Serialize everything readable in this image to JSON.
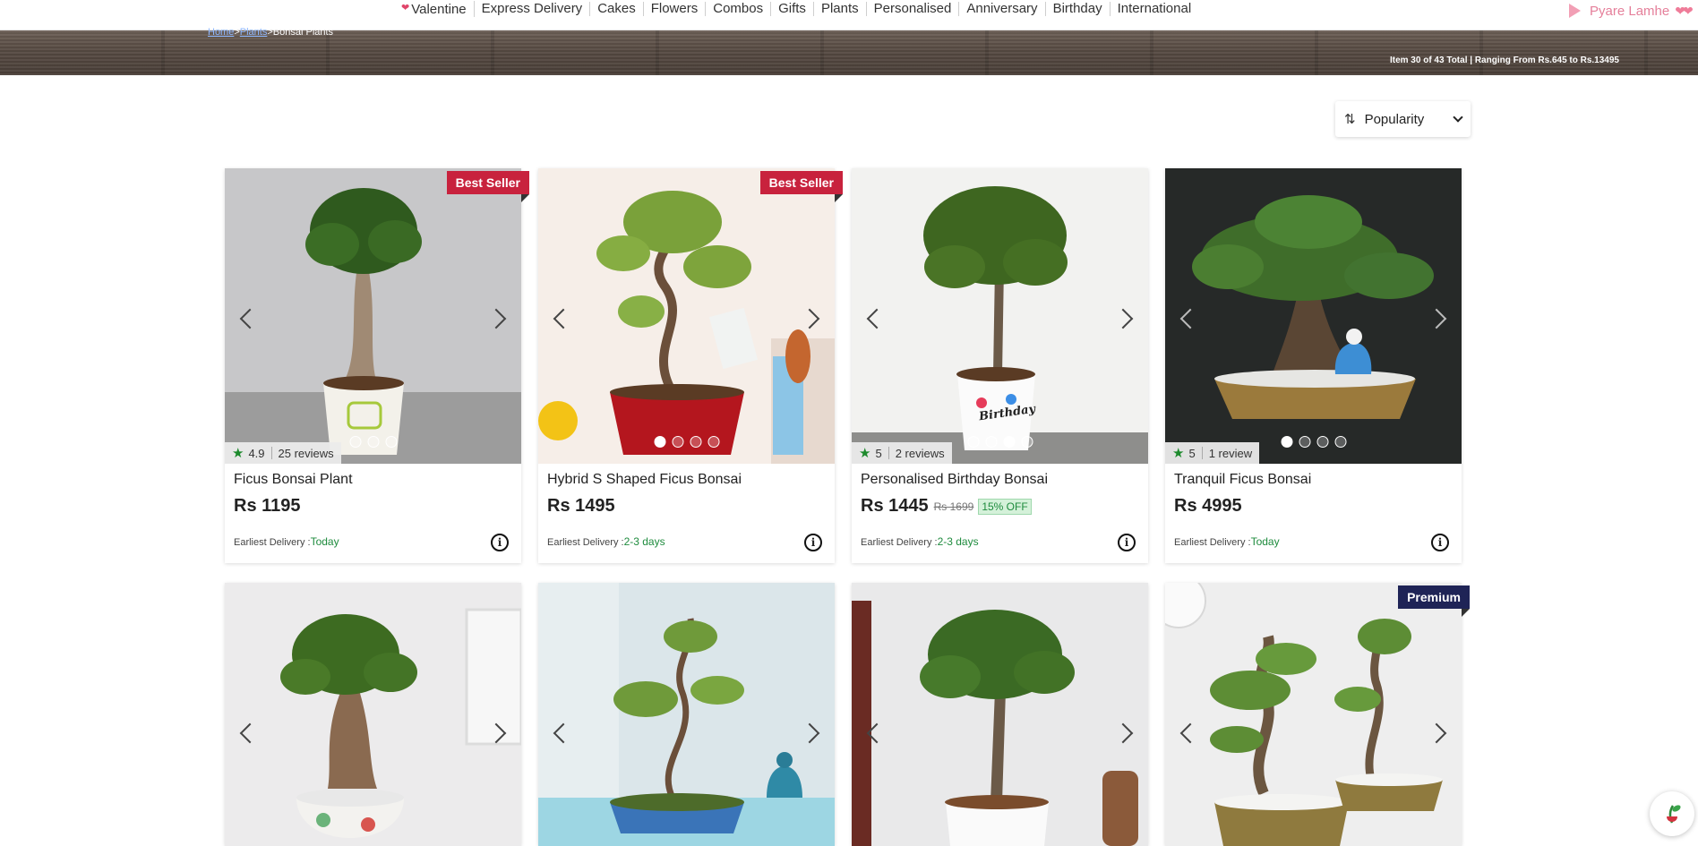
{
  "nav": {
    "items": [
      "Valentine",
      "Express Delivery",
      "Cakes",
      "Flowers",
      "Combos",
      "Gifts",
      "Plants",
      "Personalised",
      "Anniversary",
      "Birthday",
      "International"
    ],
    "promo": "Pyare Lamhe"
  },
  "breadcrumb": {
    "home": "Home",
    "sep1": ">",
    "plants": "Plants",
    "sep2": ">",
    "current": "Bonsai Plants"
  },
  "item_count": "Item 30 of 43 Total | Ranging From Rs.645 to Rs.13495",
  "sort": {
    "label": "Popularity"
  },
  "products": [
    {
      "title": "Ficus Bonsai Plant",
      "price": "Rs 1195",
      "rating": "4.9",
      "reviews": "25 reviews",
      "badge": "Best Seller",
      "delivery_label": "Earliest Delivery :",
      "delivery": "Today"
    },
    {
      "title": "Hybrid S Shaped Ficus Bonsai",
      "price": "Rs 1495",
      "badge": "Best Seller",
      "delivery_label": "Earliest Delivery :",
      "delivery": "2-3 days"
    },
    {
      "title": "Personalised Birthday Bonsai",
      "price": "Rs 1445",
      "old_price": "Rs 1699",
      "off": "15% OFF",
      "rating": "5",
      "reviews": "2 reviews",
      "delivery_label": "Earliest Delivery :",
      "delivery": "2-3 days",
      "pot_text": "Birthday"
    },
    {
      "title": "Tranquil Ficus Bonsai",
      "price": "Rs 4995",
      "rating": "5",
      "reviews": "1 review",
      "delivery_label": "Earliest Delivery :",
      "delivery": "Today"
    },
    {
      "badge": "Premium"
    }
  ]
}
